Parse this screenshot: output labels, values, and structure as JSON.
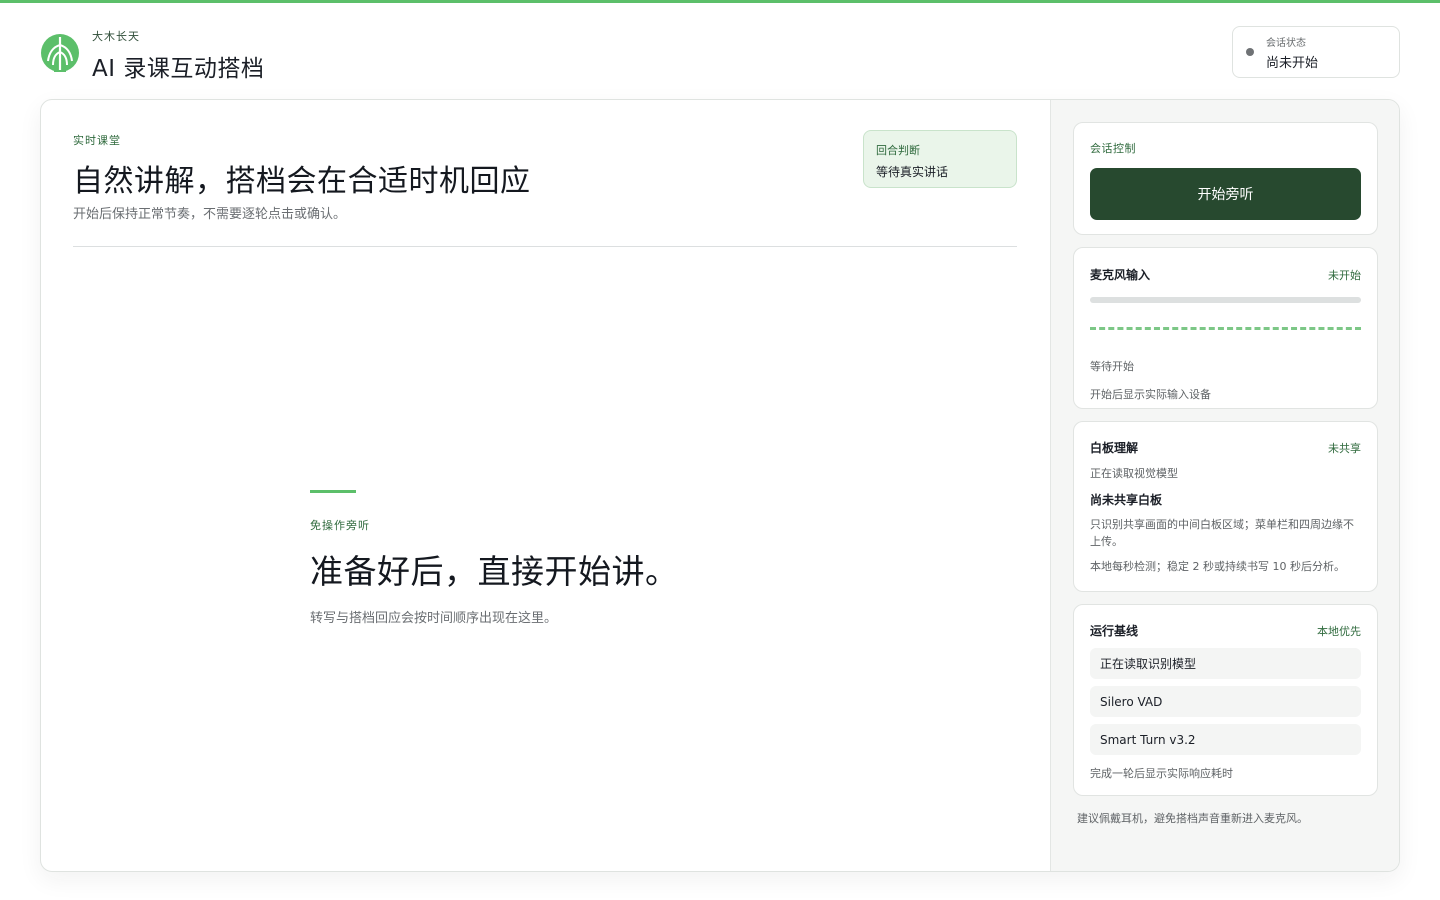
{
  "colors": {
    "accent": "#5cbf6a",
    "primary_button": "#27492f",
    "turn_box_bg": "#eaf5ea"
  },
  "header": {
    "brand_sub": "大木长天",
    "app_title": "AI 录课互动搭档",
    "logo_icon": "leaf-tree-icon",
    "status": {
      "label": "会话状态",
      "value": "尚未开始"
    }
  },
  "lesson": {
    "eyebrow": "实时课堂",
    "title": "自然讲解，搭档会在合适时机回应",
    "description": "开始后保持正常节奏，不需要逐轮点击或确认。",
    "turn": {
      "label": "回合判断",
      "value": "等待真实讲话"
    }
  },
  "empty_state": {
    "eyebrow": "免操作旁听",
    "title": "准备好后，直接开始讲。",
    "description": "转写与搭档回应会按时间顺序出现在这里。"
  },
  "sidebar": {
    "control": {
      "title": "会话控制",
      "button": "开始旁听"
    },
    "mic": {
      "title": "麦克风输入",
      "tag": "未开始",
      "level": 0,
      "status": "等待开始",
      "hint": "开始后显示实际输入设备"
    },
    "whiteboard": {
      "title": "白板理解",
      "tag": "未共享",
      "model_status": "正在读取视觉模型",
      "state": "尚未共享白板",
      "scope": "只识别共享画面的中间白板区域；菜单栏和四周边缘不上传。",
      "detect": "本地每秒检测；稳定 2 秒或持续书写 10 秒后分析。"
    },
    "baseline": {
      "title": "运行基线",
      "tag": "本地优先",
      "models": [
        "正在读取识别模型",
        "Silero VAD",
        "Smart Turn v3.2"
      ],
      "footer": "完成一轮后显示实际响应耗时"
    },
    "note": "建议佩戴耳机，避免搭档声音重新进入麦克风。"
  }
}
